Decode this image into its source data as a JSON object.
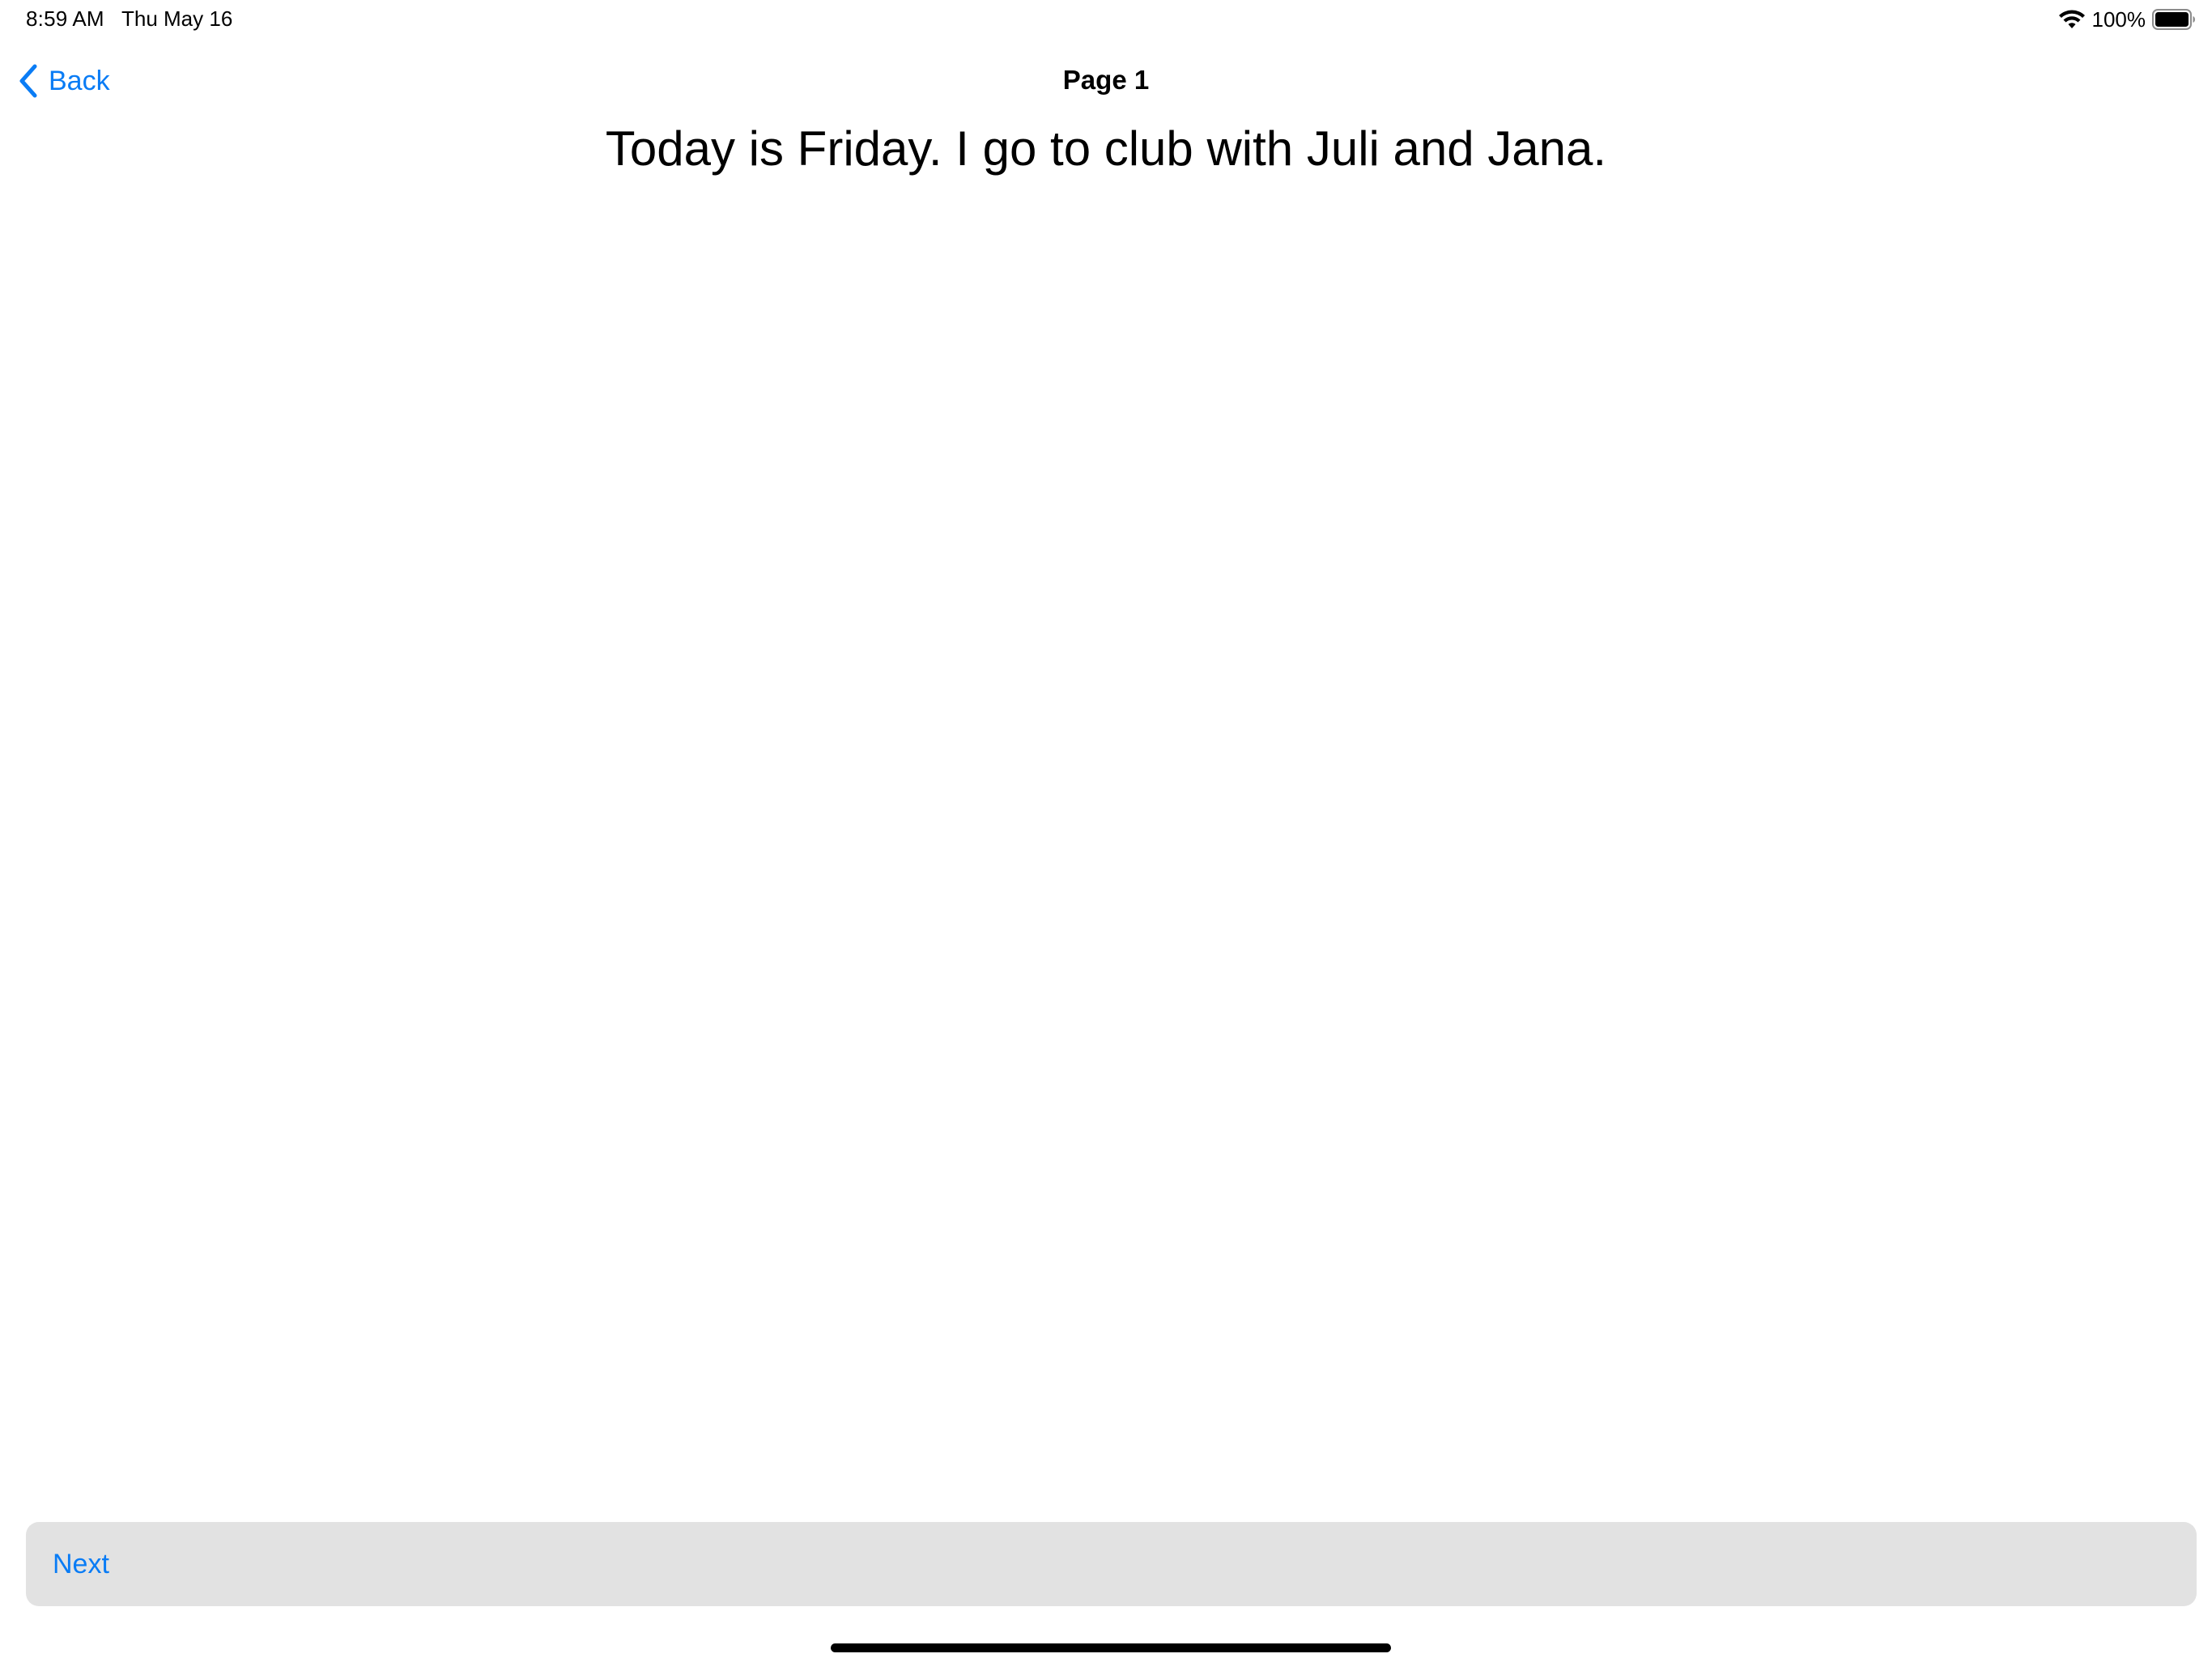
{
  "status_bar": {
    "time": "8:59 AM",
    "date": "Thu May 16",
    "battery_percent": "100%",
    "battery_level": 1.0,
    "wifi_icon": "wifi-icon",
    "battery_icon": "battery-icon"
  },
  "nav": {
    "back_label": "Back",
    "back_icon": "chevron-left-icon",
    "title": "Page 1"
  },
  "content": {
    "sentence": "Today is Friday. I go to club with Juli and Jana."
  },
  "footer": {
    "next_label": "Next"
  },
  "colors": {
    "accent": "#0a7cf5",
    "button_background": "#e2e2e2",
    "background": "#ffffff",
    "text": "#000000"
  }
}
